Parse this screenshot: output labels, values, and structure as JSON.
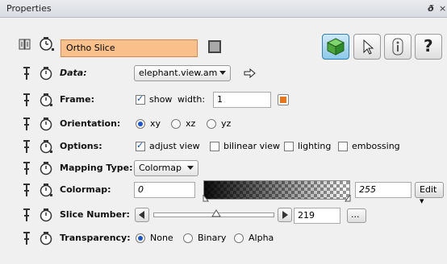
{
  "window": {
    "title": "Properties",
    "float_label": "ð",
    "close_label": "×"
  },
  "header": {
    "module_name": "Ortho Slice",
    "help_label": "?"
  },
  "rows": {
    "data": {
      "label": "Data:",
      "value": "elephant.view.am"
    },
    "frame": {
      "label": "Frame:",
      "show_label": "show",
      "show_checked": true,
      "width_label": "width:",
      "width_value": "1",
      "frame_color": "#e8741c"
    },
    "orientation": {
      "label": "Orientation:",
      "options": [
        "xy",
        "xz",
        "yz"
      ],
      "selected": "xy"
    },
    "options": {
      "label": "Options:",
      "items": [
        {
          "label": "adjust view",
          "checked": true
        },
        {
          "label": "bilinear view",
          "checked": false
        },
        {
          "label": "lighting",
          "checked": false
        },
        {
          "label": "embossing",
          "checked": false
        }
      ]
    },
    "mapping": {
      "label": "Mapping Type:",
      "value": "Colormap"
    },
    "colormap": {
      "label": "Colormap:",
      "min": "0",
      "max": "255",
      "edit_label": "Edit"
    },
    "slice": {
      "label": "Slice Number:",
      "value": "219",
      "more_label": "...",
      "position": 0.52
    },
    "transparency": {
      "label": "Transparency:",
      "options": [
        "None",
        "Binary",
        "Alpha"
      ],
      "selected": "None"
    }
  },
  "colors": {
    "module_bg": "#f9c08c",
    "module_border": "#d9874c",
    "active_tool": "#8dc8e8",
    "radio": "#1c55c7"
  }
}
